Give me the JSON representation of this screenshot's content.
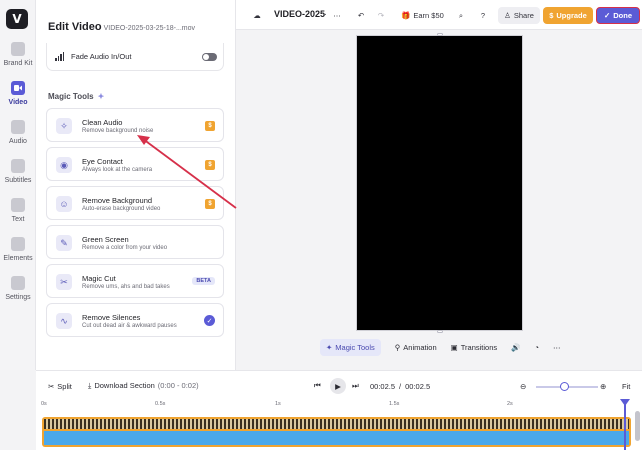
{
  "rail": {
    "items": [
      {
        "label": "Brand Kit"
      },
      {
        "label": "Video"
      },
      {
        "label": "Audio"
      },
      {
        "label": "Subtitles"
      },
      {
        "label": "Text"
      },
      {
        "label": "Elements"
      },
      {
        "label": "Settings"
      }
    ]
  },
  "panel": {
    "title": "Edit Video",
    "filename": "VIDEO-2025-03-25-18-...mov",
    "fade_label": "Fade Audio In/Out",
    "magic_title": "Magic Tools",
    "tools": [
      {
        "name": "Clean Audio",
        "desc": "Remove background noise",
        "badge": "coin"
      },
      {
        "name": "Eye Contact",
        "desc": "Always look at the camera",
        "badge": "coin"
      },
      {
        "name": "Remove Background",
        "desc": "Auto-erase background video",
        "badge": "coin"
      },
      {
        "name": "Green Screen",
        "desc": "Remove a color from your video",
        "badge": ""
      },
      {
        "name": "Magic Cut",
        "desc": "Remove ums, ahs and bad takes",
        "badge": "BETA"
      },
      {
        "name": "Remove Silences",
        "desc": "Cut out dead air & awkward pauses",
        "badge": "check"
      }
    ],
    "coin_symbol": "$"
  },
  "topbar": {
    "project_name": "VIDEO-2025-0",
    "earn": "Earn $50",
    "share": "Share",
    "upgrade": "Upgrade",
    "done": "Done"
  },
  "canvas_toolbar": {
    "magic_tools": "Magic Tools",
    "animation": "Animation",
    "transitions": "Transitions"
  },
  "timeline": {
    "split": "Split",
    "download": "Download Section",
    "download_range": "(0:00 - 0:02)",
    "current_time": "00:02.5",
    "separator": "/",
    "total_time": "00:02.5",
    "fit": "Fit",
    "ruler": [
      "0s",
      "0.5s",
      "1s",
      "1.5s",
      "2s"
    ],
    "zoom_level": 0.55
  },
  "colors": {
    "accent": "#5b5bd6",
    "upgrade": "#f0a431",
    "annotation_arrow": "#d6304a"
  }
}
